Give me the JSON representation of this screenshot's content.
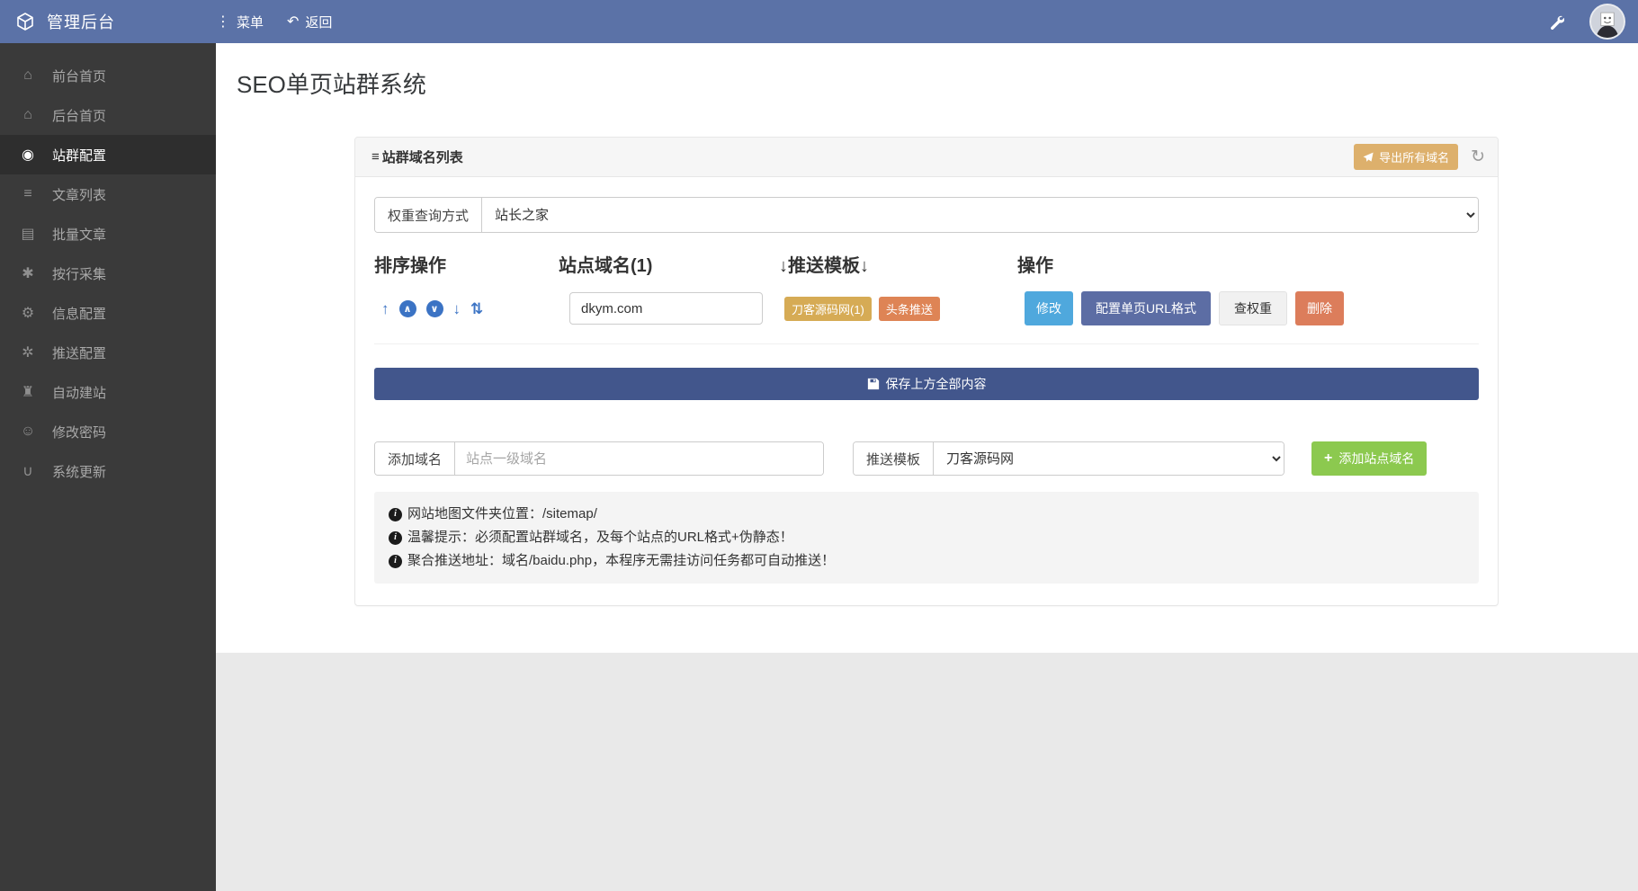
{
  "topbar": {
    "brand": "管理后台",
    "menu_label": "菜单",
    "menu_icon": "⋮",
    "back_label": "返回",
    "back_icon": "↶"
  },
  "sidebar": {
    "items": [
      {
        "icon": "⌂",
        "label": "前台首页",
        "active": false
      },
      {
        "icon": "⌂",
        "label": "后台首页",
        "active": false
      },
      {
        "icon": "◉",
        "label": "站群配置",
        "active": true
      },
      {
        "icon": "≡",
        "label": "文章列表",
        "active": false
      },
      {
        "icon": "▤",
        "label": "批量文章",
        "active": false
      },
      {
        "icon": "✱",
        "label": "按行采集",
        "active": false
      },
      {
        "icon": "⚙",
        "label": "信息配置",
        "active": false
      },
      {
        "icon": "✲",
        "label": "推送配置",
        "active": false
      },
      {
        "icon": "♜",
        "label": "自动建站",
        "active": false
      },
      {
        "icon": "☺",
        "label": "修改密码",
        "active": false
      },
      {
        "icon": "∪",
        "label": "系统更新",
        "active": false
      }
    ]
  },
  "page": {
    "title": "SEO单页站群系统"
  },
  "panel": {
    "title": "站群域名列表",
    "title_icon": "≡",
    "export_button": "导出所有域名",
    "refresh_icon": "↻",
    "weight_query": {
      "label": "权重查询方式",
      "value": "站长之家"
    },
    "table": {
      "headers": [
        "排序操作",
        "站点域名(1)",
        "↓推送模板↓",
        "操作"
      ],
      "sort_controls": [
        {
          "glyph": "↑"
        },
        {
          "glyph": "∧"
        },
        {
          "glyph": "∨"
        },
        {
          "glyph": "↓"
        },
        {
          "glyph": "⇅"
        }
      ],
      "row": {
        "domain": "dkym.com",
        "badges": [
          {
            "label": "刀客源码网(1)"
          },
          {
            "label": "头条推送"
          }
        ],
        "actions": {
          "edit": "修改",
          "url_format": "配置单页URL格式",
          "check_weight": "查权重",
          "delete": "删除"
        }
      }
    },
    "save_button": "保存上方全部内容",
    "add_domain": {
      "label": "添加域名",
      "placeholder": "站点一级域名"
    },
    "push_template": {
      "label": "推送模板",
      "value": "刀客源码网"
    },
    "add_button": "添加站点域名",
    "notes": [
      "网站地图文件夹位置：/sitemap/",
      "温馨提示：必须配置站群域名，及每个站点的URL格式+伪静态！",
      "聚合推送地址：域名/baidu.php，本程序无需挂访问任务都可自动推送！"
    ]
  },
  "colors": {
    "topbar": "#5b72a7",
    "sidebar": "#3a3a3a",
    "sidebar_active": "#2e2e2e",
    "save_bar": "#42568c",
    "edit_button": "#4fa8dd",
    "url_button": "#5c6da4",
    "weight_button": "#f1f1f1",
    "delete_button": "#dc7d5b",
    "export_button": "#ddb06c",
    "add_button": "#8cc94f",
    "badge_gold": "#d6ab55",
    "badge_orange": "#de8455"
  }
}
